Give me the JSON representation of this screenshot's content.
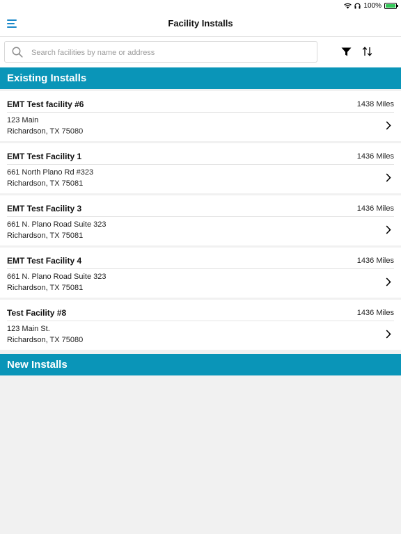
{
  "status_bar": {
    "battery_percent": "100%",
    "icons": [
      "wifi-icon",
      "headphones-icon",
      "battery-charging-icon"
    ]
  },
  "navbar": {
    "title": "Facility Installs",
    "menu_icon": "hamburger-menu-icon"
  },
  "search": {
    "placeholder": "Search facilities by name or address",
    "value": ""
  },
  "toolbar": {
    "filter_icon": "filter-icon",
    "sort_icon": "sort-icon"
  },
  "sections": {
    "existing_title": "Existing Installs",
    "new_title": "New Installs"
  },
  "facilities": [
    {
      "name": "EMT Test facility #6",
      "distance": "1438 Miles",
      "address_line1": "123 Main",
      "address_line2": "Richardson, TX 75080"
    },
    {
      "name": "EMT Test Facility 1",
      "distance": "1436 Miles",
      "address_line1": "661 North Plano Rd #323",
      "address_line2": "Richardson, TX 75081"
    },
    {
      "name": "EMT Test Facility 3",
      "distance": "1436 Miles",
      "address_line1": "661 N. Plano Road Suite 323",
      "address_line2": "Richardson, TX 75081"
    },
    {
      "name": "EMT Test Facility 4",
      "distance": "1436 Miles",
      "address_line1": "661 N. Plano Road Suite 323",
      "address_line2": "Richardson, TX 75081"
    },
    {
      "name": "Test Facility #8",
      "distance": "1436 Miles",
      "address_line1": "123 Main St.",
      "address_line2": "Richardson, TX 75080"
    }
  ],
  "colors": {
    "section_header_bg": "#0a95b8",
    "accent_blue": "#1a88c9",
    "page_bg": "#f1f1f1",
    "battery_green": "#35c759"
  }
}
